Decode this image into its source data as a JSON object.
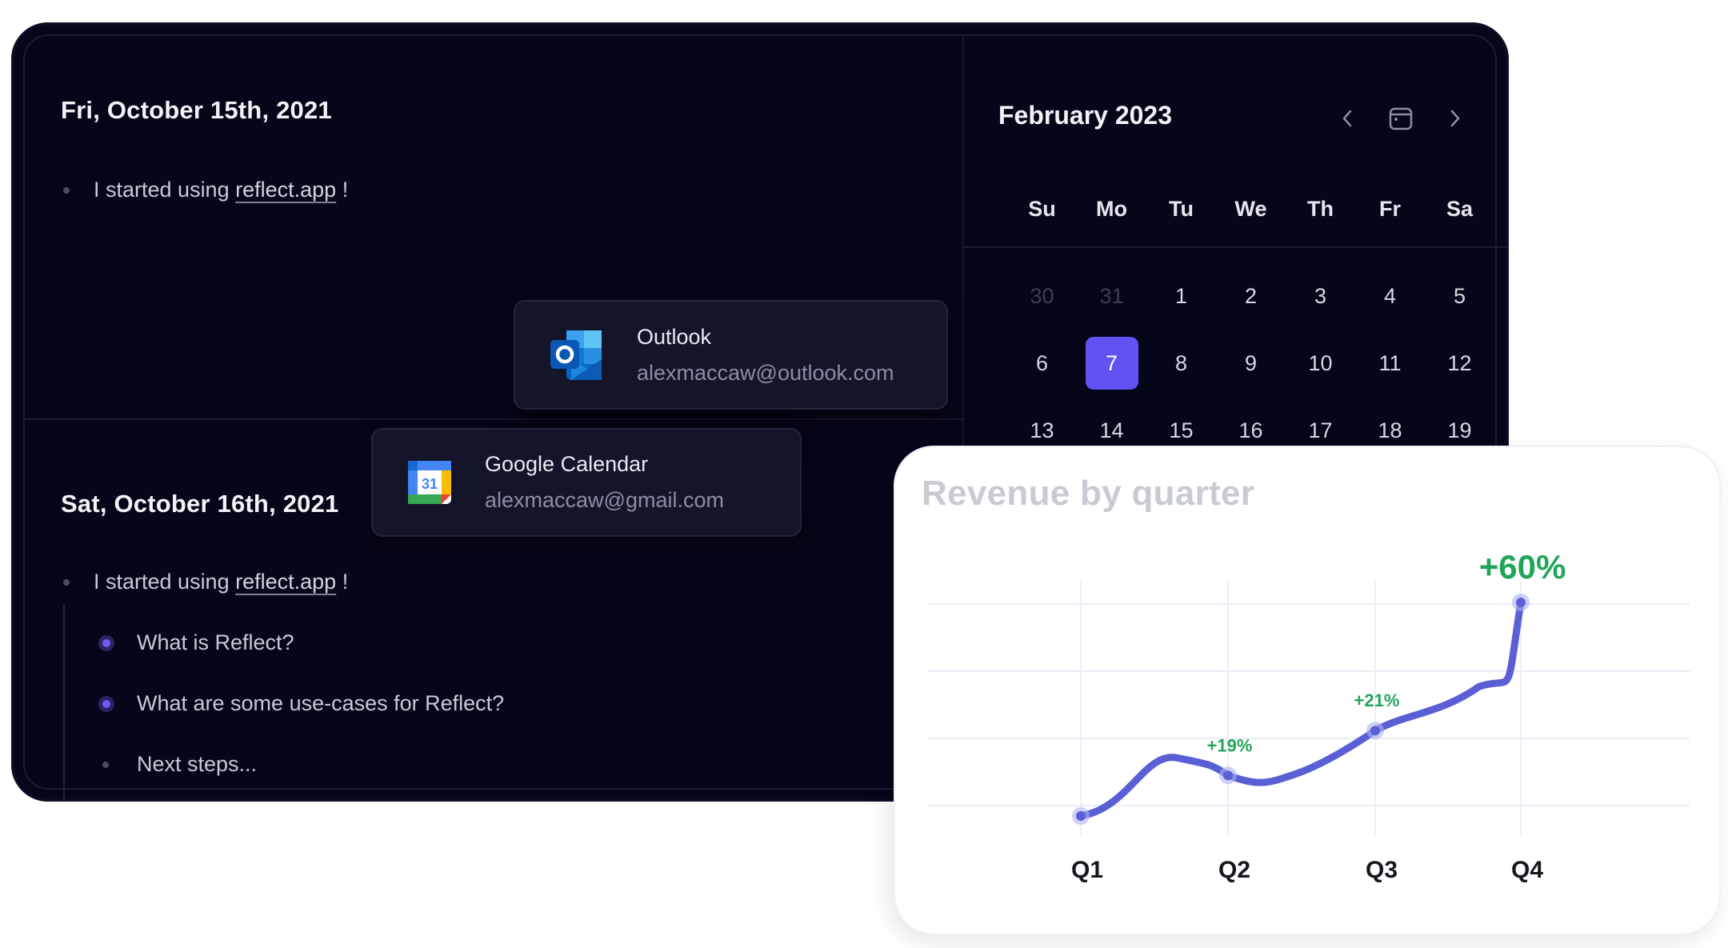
{
  "journal": {
    "days": [
      {
        "title": "Fri, October 15th, 2021",
        "line_prefix": "I started using ",
        "link": "reflect.app",
        "line_suffix": " !"
      },
      {
        "title": "Sat, October 16th, 2021",
        "line_prefix": "I started using ",
        "link": "reflect.app",
        "line_suffix": " !"
      }
    ],
    "todos": [
      {
        "label": "What is Reflect?"
      },
      {
        "label": "What are some use-cases for Reflect?"
      },
      {
        "label": "Next steps..."
      }
    ]
  },
  "accounts": [
    {
      "name": "Outlook",
      "email": "alexmaccaw@outlook.com",
      "icon": "outlook-icon"
    },
    {
      "name": "Google Calendar",
      "email": "alexmaccaw@gmail.com",
      "icon": "google-calendar-icon",
      "icon_day": "31"
    }
  ],
  "calendar": {
    "month_label": "February 2023",
    "prev_icon": "chevron-left-icon",
    "today_icon": "calendar-icon",
    "next_icon": "chevron-right-icon",
    "weekdays": [
      "Su",
      "Mo",
      "Tu",
      "We",
      "Th",
      "Fr",
      "Sa"
    ],
    "weeks": [
      [
        "30",
        "31",
        "1",
        "2",
        "3",
        "4",
        "5"
      ],
      [
        "6",
        "7",
        "8",
        "9",
        "10",
        "11",
        "12"
      ],
      [
        "13",
        "14",
        "15",
        "16",
        "17",
        "18",
        "19"
      ]
    ],
    "muted_days": [
      "30",
      "31"
    ],
    "selected_day": "7",
    "accent": "#6252f2"
  },
  "chart_data": {
    "type": "line",
    "title": "Revenue by quarter",
    "categories": [
      "Q1",
      "Q2",
      "Q3",
      "Q4"
    ],
    "values": [
      0,
      19,
      40,
      100
    ],
    "annotations": [
      "",
      "+19%",
      "+21%",
      "+60%"
    ],
    "line_color": "#5b5fd6",
    "annotation_color": "#22a55a",
    "grid": true
  }
}
